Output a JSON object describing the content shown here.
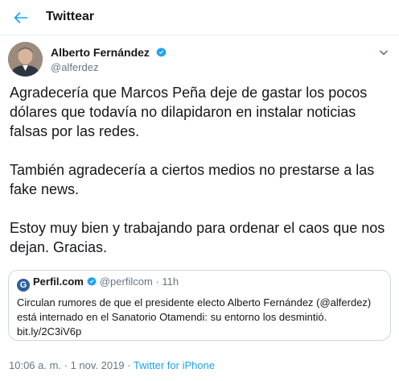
{
  "header": {
    "title": "Twittear",
    "back_icon": "arrow-left-icon"
  },
  "author": {
    "name": "Alberto Fernández",
    "handle": "@alferdez",
    "verified_icon": "verified-badge-icon",
    "caret_icon": "chevron-down-icon"
  },
  "tweet": {
    "paragraphs": [
      "Agradecería que Marcos Peña deje de gastar los pocos dólares que todavía no dilapidaron en instalar noticias falsas por las redes.",
      "También agradecería a ciertos medios no prestarse a las fake news.",
      "Estoy muy bien y trabajando para ordenar el caos que nos dejan. Gracias."
    ]
  },
  "quote": {
    "logo_letter": "G",
    "name": "Perfil.com",
    "handle": "@perfilcom",
    "separator": "·",
    "time": "11h",
    "text": "Circulan rumores de que el presidente electo Alberto Fernández (@alferdez) está internado en el Sanatorio Otamendi: su entorno los desmintió. bit.ly/2C3iV6p"
  },
  "footer": {
    "timestamp": "10:06 a. m. · 1 nov. 2019 · ",
    "source": "Twitter for iPhone"
  },
  "colors": {
    "accent": "#1da1f2",
    "text": "#14171a",
    "secondary": "#657786",
    "border": "#e6ecf0"
  }
}
